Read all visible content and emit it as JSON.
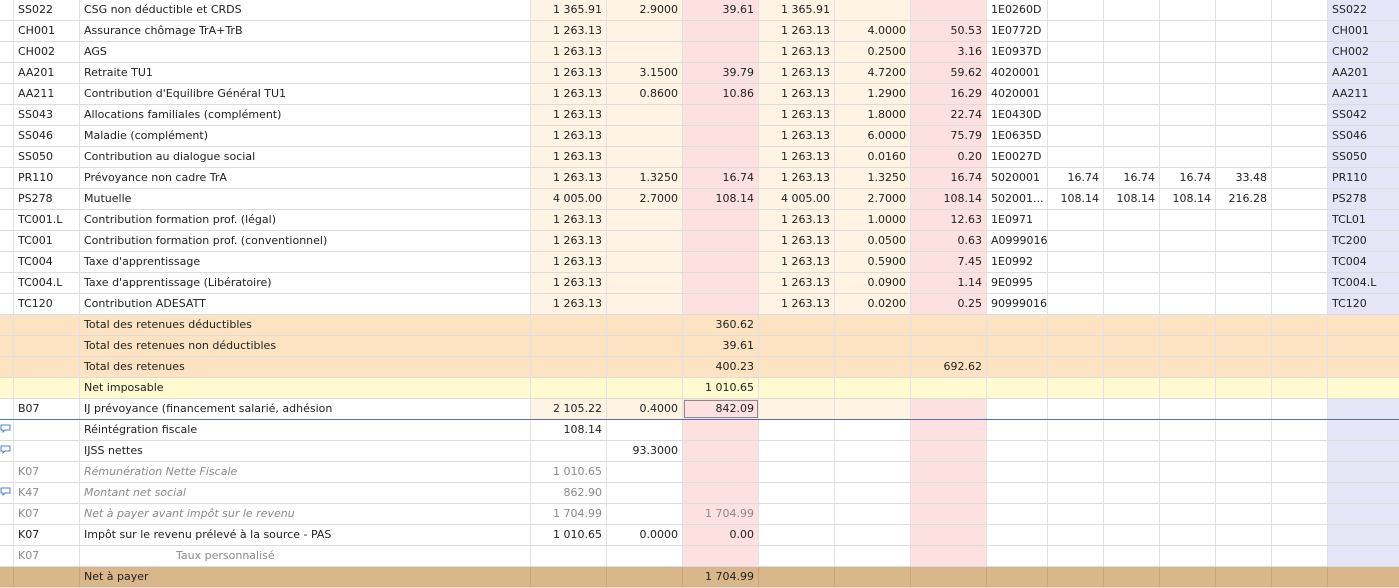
{
  "rows": [
    {
      "type": "normal",
      "code": "SS022",
      "label": "CSG non déductible et CRDS",
      "base": "1 365.91",
      "tauxs": "2.9000",
      "mts": "39.61",
      "basep": "1 365.91",
      "tauxp": "",
      "mtp": "",
      "compte": "1E0260D",
      "x1": "",
      "x2": "",
      "x3": "",
      "x4": "",
      "x5": "",
      "code2": "SS022"
    },
    {
      "type": "normal",
      "code": "CH001",
      "label": "Assurance chômage TrA+TrB",
      "base": "1 263.13",
      "tauxs": "",
      "mts": "",
      "basep": "1 263.13",
      "tauxp": "4.0000",
      "mtp": "50.53",
      "compte": "1E0772D",
      "x1": "",
      "x2": "",
      "x3": "",
      "x4": "",
      "x5": "",
      "code2": "CH001"
    },
    {
      "type": "normal",
      "code": "CH002",
      "label": "AGS",
      "base": "1 263.13",
      "tauxs": "",
      "mts": "",
      "basep": "1 263.13",
      "tauxp": "0.2500",
      "mtp": "3.16",
      "compte": "1E0937D",
      "x1": "",
      "x2": "",
      "x3": "",
      "x4": "",
      "x5": "",
      "code2": "CH002"
    },
    {
      "type": "normal",
      "code": "AA201",
      "label": "Retraite TU1",
      "base": "1 263.13",
      "tauxs": "3.1500",
      "mts": "39.79",
      "basep": "1 263.13",
      "tauxp": "4.7200",
      "mtp": "59.62",
      "compte": "4020001",
      "x1": "",
      "x2": "",
      "x3": "",
      "x4": "",
      "x5": "",
      "code2": "AA201"
    },
    {
      "type": "normal",
      "code": "AA211",
      "label": "Contribution d'Equilibre Général TU1",
      "base": "1 263.13",
      "tauxs": "0.8600",
      "mts": "10.86",
      "basep": "1 263.13",
      "tauxp": "1.2900",
      "mtp": "16.29",
      "compte": "4020001",
      "x1": "",
      "x2": "",
      "x3": "",
      "x4": "",
      "x5": "",
      "code2": "AA211"
    },
    {
      "type": "normal",
      "code": "SS043",
      "label": "Allocations familiales (complément)",
      "base": "1 263.13",
      "tauxs": "",
      "mts": "",
      "basep": "1 263.13",
      "tauxp": "1.8000",
      "mtp": "22.74",
      "compte": "1E0430D",
      "x1": "",
      "x2": "",
      "x3": "",
      "x4": "",
      "x5": "",
      "code2": "SS042"
    },
    {
      "type": "normal",
      "code": "SS046",
      "label": "Maladie (complément)",
      "base": "1 263.13",
      "tauxs": "",
      "mts": "",
      "basep": "1 263.13",
      "tauxp": "6.0000",
      "mtp": "75.79",
      "compte": "1E0635D",
      "x1": "",
      "x2": "",
      "x3": "",
      "x4": "",
      "x5": "",
      "code2": "SS046"
    },
    {
      "type": "normal",
      "code": "SS050",
      "label": "Contribution au dialogue social",
      "base": "1 263.13",
      "tauxs": "",
      "mts": "",
      "basep": "1 263.13",
      "tauxp": "0.0160",
      "mtp": "0.20",
      "compte": "1E0027D",
      "x1": "",
      "x2": "",
      "x3": "",
      "x4": "",
      "x5": "",
      "code2": "SS050"
    },
    {
      "type": "normal",
      "code": "PR110",
      "label": "Prévoyance non cadre TrA",
      "base": "1 263.13",
      "tauxs": "1.3250",
      "mts": "16.74",
      "basep": "1 263.13",
      "tauxp": "1.3250",
      "mtp": "16.74",
      "compte": "5020001",
      "x1": "16.74",
      "x2": "16.74",
      "x3": "16.74",
      "x4": "33.48",
      "x5": "",
      "code2": "PR110"
    },
    {
      "type": "normal",
      "code": "PS278",
      "label": "Mutuelle",
      "base": "4 005.00",
      "tauxs": "2.7000",
      "mts": "108.14",
      "basep": "4 005.00",
      "tauxp": "2.7000",
      "mtp": "108.14",
      "compte": "502001...",
      "x1": "108.14",
      "x2": "108.14",
      "x3": "108.14",
      "x4": "216.28",
      "x5": "",
      "code2": "PS278"
    },
    {
      "type": "normal",
      "code": "TC001.L",
      "label": "Contribution formation prof. (légal)",
      "base": "1 263.13",
      "tauxs": "",
      "mts": "",
      "basep": "1 263.13",
      "tauxp": "1.0000",
      "mtp": "12.63",
      "compte": "1E0971",
      "x1": "",
      "x2": "",
      "x3": "",
      "x4": "",
      "x5": "",
      "code2": "TCL01"
    },
    {
      "type": "normal",
      "code": "TC001",
      "label": "Contribution formation prof. (conventionnel)",
      "base": "1 263.13",
      "tauxs": "",
      "mts": "",
      "basep": "1 263.13",
      "tauxp": "0.0500",
      "mtp": "0.63",
      "compte": "A0999016",
      "x1": "",
      "x2": "",
      "x3": "",
      "x4": "",
      "x5": "",
      "code2": "TC200"
    },
    {
      "type": "normal",
      "code": "TC004",
      "label": "Taxe d'apprentissage",
      "base": "1 263.13",
      "tauxs": "",
      "mts": "",
      "basep": "1 263.13",
      "tauxp": "0.5900",
      "mtp": "7.45",
      "compte": "1E0992",
      "x1": "",
      "x2": "",
      "x3": "",
      "x4": "",
      "x5": "",
      "code2": "TC004"
    },
    {
      "type": "normal",
      "code": "TC004.L",
      "label": "Taxe d'apprentissage (Libératoire)",
      "base": "1 263.13",
      "tauxs": "",
      "mts": "",
      "basep": "1 263.13",
      "tauxp": "0.0900",
      "mtp": "1.14",
      "compte": "9E0995",
      "x1": "",
      "x2": "",
      "x3": "",
      "x4": "",
      "x5": "",
      "code2": "TC004.L"
    },
    {
      "type": "normal",
      "code": "TC120",
      "label": "Contribution ADESATT",
      "base": "1 263.13",
      "tauxs": "",
      "mts": "",
      "basep": "1 263.13",
      "tauxp": "0.0200",
      "mtp": "0.25",
      "compte": "90999016",
      "x1": "",
      "x2": "",
      "x3": "",
      "x4": "",
      "x5": "",
      "code2": "TC120"
    },
    {
      "type": "total",
      "code": "",
      "label": "Total des retenues déductibles",
      "base": "",
      "tauxs": "",
      "mts": "360.62",
      "basep": "",
      "tauxp": "",
      "mtp": "",
      "compte": "",
      "x1": "",
      "x2": "",
      "x3": "",
      "x4": "",
      "x5": "",
      "code2": ""
    },
    {
      "type": "total",
      "code": "",
      "label": "Total des retenues non déductibles",
      "base": "",
      "tauxs": "",
      "mts": "39.61",
      "basep": "",
      "tauxp": "",
      "mtp": "",
      "compte": "",
      "x1": "",
      "x2": "",
      "x3": "",
      "x4": "",
      "x5": "",
      "code2": ""
    },
    {
      "type": "total",
      "code": "",
      "label": "Total des retenues",
      "base": "",
      "tauxs": "",
      "mts": "400.23",
      "basep": "",
      "tauxp": "",
      "mtp": "692.62",
      "compte": "",
      "x1": "",
      "x2": "",
      "x3": "",
      "x4": "",
      "x5": "",
      "code2": ""
    },
    {
      "type": "netimp",
      "code": "",
      "label": "Net imposable",
      "base": "",
      "tauxs": "",
      "mts": "1 010.65",
      "basep": "",
      "tauxp": "",
      "mtp": "",
      "compte": "",
      "x1": "",
      "x2": "",
      "x3": "",
      "x4": "",
      "x5": "",
      "code2": ""
    },
    {
      "type": "selected",
      "code": "B07",
      "label": "IJ prévoyance (financement salarié, adhésion",
      "base": "2 105.22",
      "tauxs": "0.4000",
      "mts": "842.09",
      "basep": "",
      "tauxp": "",
      "mtp": "",
      "compte": "",
      "x1": "",
      "x2": "",
      "x3": "",
      "x4": "",
      "x5": "",
      "code2": ""
    },
    {
      "type": "plain",
      "comment": true,
      "code": "",
      "label": "Réintégration fiscale",
      "base": "108.14",
      "tauxs": "",
      "mts": "",
      "basep": "",
      "tauxp": "",
      "mtp": "",
      "compte": "",
      "x1": "",
      "x2": "",
      "x3": "",
      "x4": "",
      "x5": "",
      "code2": ""
    },
    {
      "type": "plain",
      "comment": true,
      "code": "",
      "label": "IJSS nettes",
      "base": "",
      "tauxs": "93.3000",
      "mts": "",
      "basep": "",
      "tauxp": "",
      "mtp": "",
      "compte": "",
      "x1": "",
      "x2": "",
      "x3": "",
      "x4": "",
      "x5": "",
      "code2": ""
    },
    {
      "type": "grey",
      "code": "K07",
      "label": "Rémunération Nette Fiscale",
      "base": "1 010.65",
      "tauxs": "",
      "mts": "",
      "basep": "",
      "tauxp": "",
      "mtp": "",
      "compte": "",
      "x1": "",
      "x2": "",
      "x3": "",
      "x4": "",
      "x5": "",
      "code2": ""
    },
    {
      "type": "grey",
      "comment": true,
      "code": "K47",
      "label": "Montant net social",
      "base": "862.90",
      "tauxs": "",
      "mts": "",
      "basep": "",
      "tauxp": "",
      "mtp": "",
      "compte": "",
      "x1": "",
      "x2": "",
      "x3": "",
      "x4": "",
      "x5": "",
      "code2": ""
    },
    {
      "type": "grey",
      "code": "K07",
      "label": "Net à payer avant impôt sur le revenu",
      "base": "1 704.99",
      "tauxs": "",
      "mts": "1 704.99",
      "basep": "",
      "tauxp": "",
      "mtp": "",
      "compte": "",
      "x1": "",
      "x2": "",
      "x3": "",
      "x4": "",
      "x5": "",
      "code2": ""
    },
    {
      "type": "plain",
      "code": "K07",
      "label": "Impôt sur le revenu prélevé à la source - PAS",
      "base": "1 010.65",
      "tauxs": "0.0000",
      "mts": "0.00",
      "basep": "",
      "tauxp": "",
      "mtp": "",
      "compte": "",
      "x1": "",
      "x2": "",
      "x3": "",
      "x4": "",
      "x5": "",
      "code2": ""
    },
    {
      "type": "grey-indent",
      "code": "K07",
      "label": "Taux personnalisé",
      "base": "",
      "tauxs": "",
      "mts": "",
      "basep": "",
      "tauxp": "",
      "mtp": "",
      "compte": "",
      "x1": "",
      "x2": "",
      "x3": "",
      "x4": "",
      "x5": "",
      "code2": ""
    },
    {
      "type": "net",
      "code": "",
      "label": "Net à payer",
      "base": "",
      "tauxs": "",
      "mts": "1 704.99",
      "basep": "",
      "tauxp": "",
      "mtp": "",
      "compte": "",
      "x1": "",
      "x2": "",
      "x3": "",
      "x4": "",
      "x5": "",
      "code2": ""
    }
  ],
  "icons": {
    "comment": "comment-icon"
  }
}
